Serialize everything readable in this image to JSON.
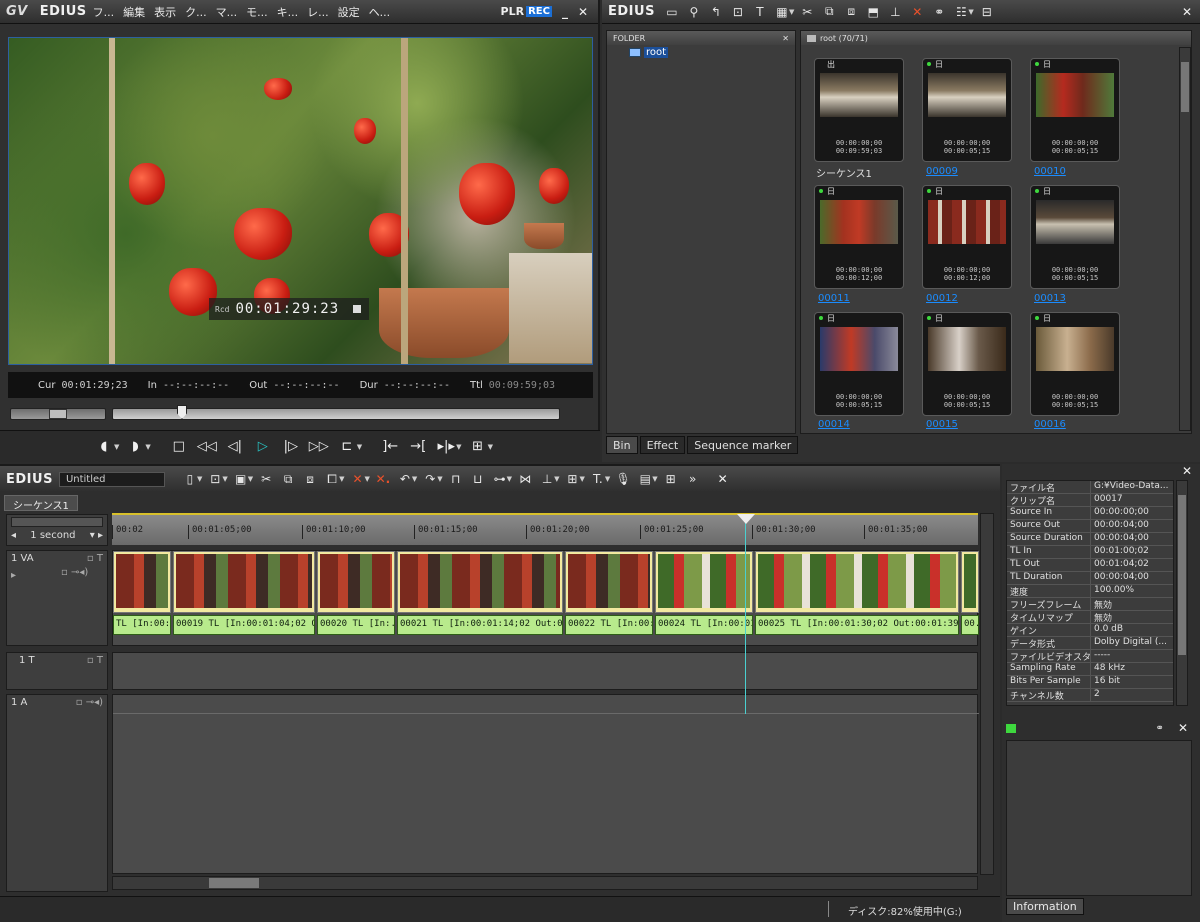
{
  "app": {
    "logo": "EDIUS",
    "brand": "GV"
  },
  "player": {
    "menu": [
      "フ...",
      "編集",
      "表示",
      "ク...",
      "マ...",
      "モ...",
      "キ...",
      "レ...",
      "設定",
      "ヘ..."
    ],
    "plr_label": "PLR",
    "rec_label": "REC",
    "overlay_label": "Rcd",
    "overlay_timecode": "00:01:29:23",
    "cur_label": "Cur",
    "cur_value": "00:01:29;23",
    "in_label": "In",
    "in_value": "--:--:--:--",
    "out_label": "Out",
    "out_value": "--:--:--:--",
    "dur_label": "Dur",
    "dur_value": "--:--:--:--",
    "ttl_label": "Ttl",
    "ttl_value": "00:09:59;03"
  },
  "bin": {
    "logo": "EDIUS",
    "folder_header": "FOLDER",
    "root_folder": "root",
    "clips_header": "root (70/71)",
    "tabs": [
      "Bin",
      "Effect",
      "Sequence marker"
    ],
    "clips": [
      {
        "name": "シーケンス1",
        "tc1": "00:00:00;00",
        "tc2": "00:09:59;03",
        "head": "出"
      },
      {
        "name": "00009",
        "tc1": "00:00:00;00",
        "tc2": "00:00:05;15",
        "head": "日"
      },
      {
        "name": "00010",
        "tc1": "00:00:00;00",
        "tc2": "00:00:05;15",
        "head": "日"
      },
      {
        "name": "00011",
        "tc1": "00:00:00;00",
        "tc2": "00:00:12;00",
        "head": "日"
      },
      {
        "name": "00012",
        "tc1": "00:00:00;00",
        "tc2": "00:00:12;00",
        "head": "日"
      },
      {
        "name": "00013",
        "tc1": "00:00:00;00",
        "tc2": "00:00:05;15",
        "head": "日"
      },
      {
        "name": "00014",
        "tc1": "00:00:00;00",
        "tc2": "00:00:05;15",
        "head": "日"
      },
      {
        "name": "00015",
        "tc1": "00:00:00;00",
        "tc2": "00:00:05;15",
        "head": "日"
      },
      {
        "name": "00016",
        "tc1": "00:00:00;00",
        "tc2": "00:00:05;15",
        "head": "日"
      }
    ]
  },
  "timeline": {
    "logo": "EDIUS",
    "project_title": "Untitled",
    "sequence_tab": "シーケンス1",
    "scale": "1 second",
    "ruler": [
      "00:02",
      "00:01:05;00",
      "00:01:10;00",
      "00:01:15;00",
      "00:01:20;00",
      "00:01:25;00",
      "00:01:30;00",
      "00:01:35;00"
    ],
    "tracks": {
      "va": "1 VA",
      "t": "1 T",
      "a": "1 A"
    },
    "audio_clips": [
      "TL [In:00:",
      "00019  TL [In:00:01:04;02 Out:...",
      "00020  TL [In:...",
      "00021  TL [In:00:01:14;02 Out:00:...",
      "00022  TL [In:00:...",
      "00024  TL [In:00:01...",
      "00025  TL [In:00:01:30;02 Out:00:01:39;02...",
      "00..."
    ],
    "status_disk": "ディスク:82%使用中(G:)"
  },
  "info": {
    "tab": "Information",
    "properties": [
      [
        "ファイル名",
        "G:¥Video-Data..."
      ],
      [
        "クリップ名",
        "00017"
      ],
      [
        "Source In",
        "00:00:00;00"
      ],
      [
        "Source Out",
        "00:00:04;00"
      ],
      [
        "Source Duration",
        "00:00:04;00"
      ],
      [
        "TL In",
        "00:01:00;02"
      ],
      [
        "TL Out",
        "00:01:04;02"
      ],
      [
        "TL Duration",
        "00:00:04;00"
      ],
      [
        "速度",
        "100.00%"
      ],
      [
        "フリーズフレーム",
        "無効"
      ],
      [
        "タイムリマップ",
        "無効"
      ],
      [
        "ゲイン",
        "0.0 dB"
      ],
      [
        "データ形式",
        "Dolby Digital (..."
      ],
      [
        "ファイルビデオスタ...",
        "-----"
      ],
      [
        "Sampling Rate",
        "48 kHz"
      ],
      [
        "Bits Per Sample",
        "16 bit"
      ],
      [
        "チャンネル数",
        "2"
      ]
    ]
  }
}
